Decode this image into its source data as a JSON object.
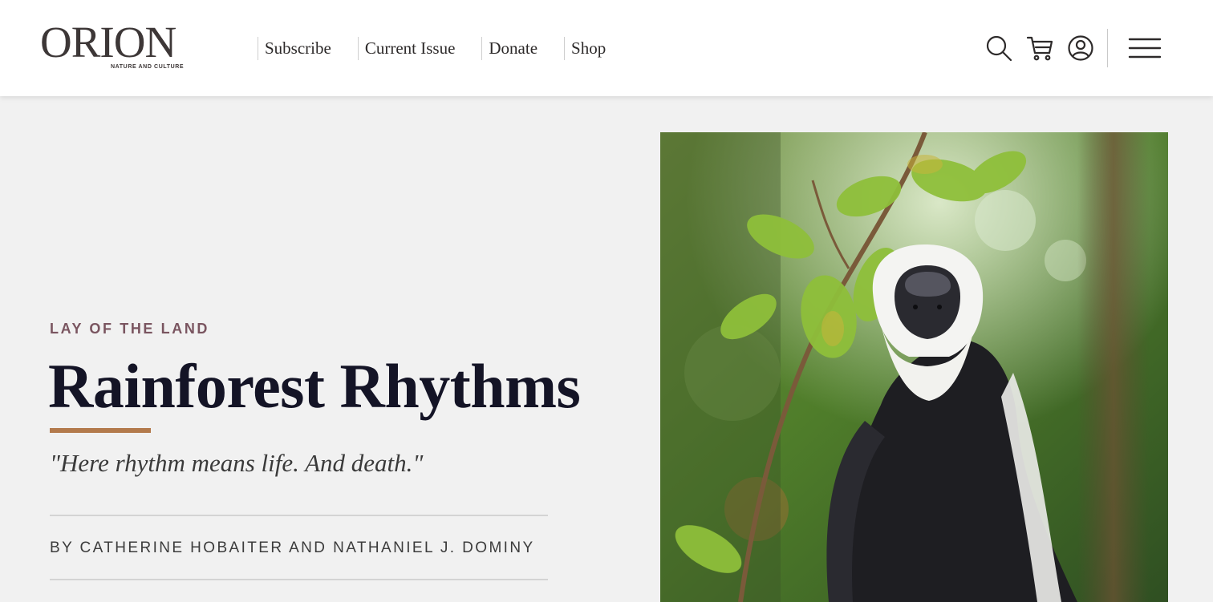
{
  "site": {
    "logo_text": "ORION",
    "logo_tagline": "NATURE AND CULTURE"
  },
  "nav": {
    "items": [
      {
        "label": "Subscribe"
      },
      {
        "label": "Current Issue"
      },
      {
        "label": "Donate"
      },
      {
        "label": "Shop"
      }
    ]
  },
  "toolbar": {
    "icons": [
      "search-icon",
      "cart-icon",
      "account-icon",
      "menu-icon"
    ]
  },
  "article": {
    "kicker": "LAY OF THE LAND",
    "title": "Rainforest Rhythms",
    "dek": "\"Here rhythm means life. And death.\"",
    "byline": "BY CATHERINE HOBAITER AND NATHANIEL J. DOMINY"
  },
  "colors": {
    "header_bg": "#ffffff",
    "page_bg": "#f1f1f1",
    "kicker": "#7a5560",
    "title": "#141426",
    "accent_rule": "#b37a4c"
  }
}
